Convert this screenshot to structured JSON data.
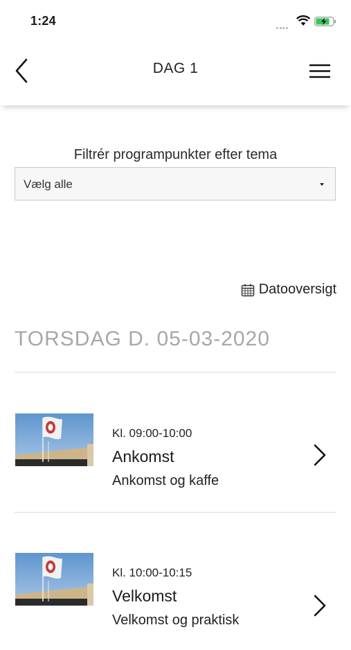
{
  "status_bar": {
    "time": "1:24",
    "icons": [
      "signal-dots-icon",
      "wifi-icon",
      "battery-charging-icon"
    ],
    "battery_color": "#34c759"
  },
  "header": {
    "title": "DAG 1",
    "back_icon": "chevron-left-icon",
    "menu_icon": "hamburger-menu-icon"
  },
  "filter": {
    "label": "Filtrér programpunkter efter tema",
    "selected_value": "Vælg alle"
  },
  "date_overview": {
    "icon": "calendar-icon",
    "label": "Datooversigt"
  },
  "date_heading": "TORSDAG D. 05-03-2020",
  "program_items": [
    {
      "time": "Kl. 09:00-10:00",
      "title": "Ankomst",
      "subtitle": "Ankomst og kaffe",
      "icon": "chevron-right-icon"
    },
    {
      "time": "Kl. 10:00-10:15",
      "title": "Velkomst",
      "subtitle": "Velkomst og praktisk",
      "icon": "chevron-right-icon"
    }
  ]
}
